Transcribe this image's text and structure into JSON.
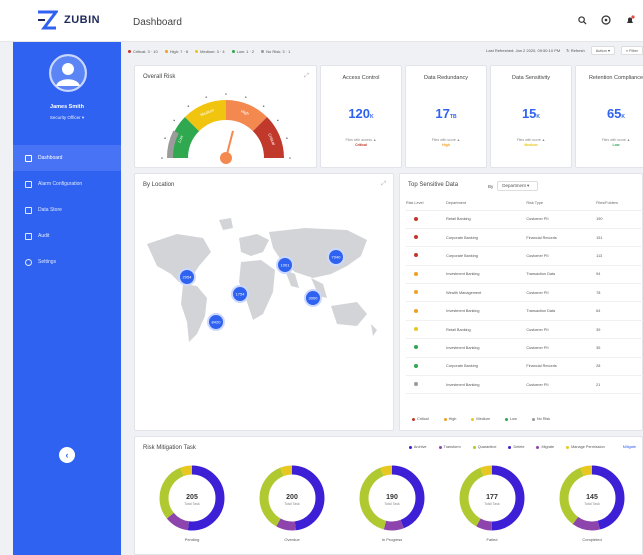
{
  "app": {
    "logo_text": "ZUBIN",
    "page_title": "Dashboard"
  },
  "user": {
    "name": "James Smith",
    "role": "Security Officer"
  },
  "nav": [
    {
      "label": "Dashboard",
      "active": true
    },
    {
      "label": "Alarm Configuration"
    },
    {
      "label": "Data Store"
    },
    {
      "label": "Audit"
    },
    {
      "label": "Settings"
    }
  ],
  "filters": {
    "risk_legend": [
      {
        "label": "Critical: 3 · 10",
        "color": "#c0392b"
      },
      {
        "label": "High: 7 · 8",
        "color": "#f0a020"
      },
      {
        "label": "Medium: 3 · 4",
        "color": "#e6c820"
      },
      {
        "label": "Low: 1 · 2",
        "color": "#2fa84f"
      },
      {
        "label": "No Risk: 3 · 1",
        "color": "#999999"
      }
    ],
    "last_refreshed": "Last Refreshed: Jan 2 2020, 09:50:10 PM",
    "refresh_label": "Refresh",
    "action_label": "Action",
    "filter_label": "Filter"
  },
  "gauge": {
    "title": "Overall Risk",
    "levels": [
      "Low",
      "Medium",
      "High",
      "Critical"
    ],
    "level_colors": [
      "#2fa84f",
      "#f1c40f",
      "#f3894f",
      "#c0392b"
    ],
    "needle_fraction": 0.58
  },
  "metrics": [
    {
      "title": "Access Control",
      "value": "120",
      "unit": "K",
      "note_prefix": "Files with access ▲",
      "note_level": "Critical",
      "note_color": "#c0392b"
    },
    {
      "title": "Data Redundancy",
      "value": "17",
      "unit": "TB",
      "note_prefix": "Files with score ▲",
      "note_level": "High",
      "note_color": "#f0a020"
    },
    {
      "title": "Data Sensitivity",
      "value": "15",
      "unit": "K",
      "note_prefix": "Files with score ▲",
      "note_level": "Medium",
      "note_color": "#e6c820"
    },
    {
      "title": "Retention Compliance",
      "value": "65",
      "unit": "K",
      "note_prefix": "Files with score ▲",
      "note_level": "Low",
      "note_color": "#2fa84f"
    }
  ],
  "location": {
    "title": "By Location",
    "bubbles": [
      "2054",
      "8420",
      "1001",
      "7040",
      "3000",
      "1754"
    ]
  },
  "sensitive": {
    "title": "Top Sensitive Data",
    "by_label": "By",
    "group_by": "Department",
    "columns": [
      "Risk Level",
      "Department",
      "Risk Type",
      "Files/Folders"
    ],
    "rows": [
      {
        "color": "#c0392b",
        "department": "Retail Banking",
        "risk_type": "Customer PII",
        "files": "190"
      },
      {
        "color": "#c0392b",
        "department": "Corporate Banking",
        "risk_type": "Financial Records",
        "files": "151"
      },
      {
        "color": "#c0392b",
        "department": "Corporate Banking",
        "risk_type": "Customer PII",
        "files": "113"
      },
      {
        "color": "#f0a020",
        "department": "Investment Banking",
        "risk_type": "Transaction Data",
        "files": "94"
      },
      {
        "color": "#f0a020",
        "department": "Wealth Management",
        "risk_type": "Customer PII",
        "files": "78"
      },
      {
        "color": "#f0a020",
        "department": "Investment Banking",
        "risk_type": "Transaction Data",
        "files": "64"
      },
      {
        "color": "#e6c820",
        "department": "Retail Banking",
        "risk_type": "Customer PII",
        "files": "39"
      },
      {
        "color": "#2fa84f",
        "department": "Investment Banking",
        "risk_type": "Customer PII",
        "files": "35"
      },
      {
        "color": "#2fa84f",
        "department": "Corporate Banking",
        "risk_type": "Financial Records",
        "files": "28"
      },
      {
        "color": "#999999",
        "department": "Investment Banking",
        "risk_type": "Customer PII",
        "files": "21"
      }
    ],
    "legend": [
      {
        "label": "Critical",
        "color": "#c0392b"
      },
      {
        "label": "High",
        "color": "#f0a020"
      },
      {
        "label": "Medium",
        "color": "#e6c820"
      },
      {
        "label": "Low",
        "color": "#2fa84f"
      },
      {
        "label": "No Risk",
        "color": "#999999"
      }
    ]
  },
  "mitigation": {
    "title": "Risk Mitigation Task",
    "legend": [
      {
        "label": "Archive",
        "color": "#3d1fd6"
      },
      {
        "label": "Transform",
        "color": "#8e44ad"
      },
      {
        "label": "Quarantine",
        "color": "#b0c930"
      },
      {
        "label": "Delete",
        "color": "#3d1fd6"
      },
      {
        "label": "Migrate",
        "color": "#8e44ad"
      },
      {
        "label": "Manage Permission",
        "color": "#e6c820"
      }
    ],
    "link_label": "Mitigate",
    "donut_sub": "Total Task",
    "donuts": [
      {
        "total": "205",
        "status": "Pending",
        "segments": [
          0.52,
          0.12,
          0.3,
          0.06
        ]
      },
      {
        "total": "200",
        "status": "Overdue",
        "segments": [
          0.48,
          0.1,
          0.36,
          0.06
        ]
      },
      {
        "total": "190",
        "status": "In Progress",
        "segments": [
          0.44,
          0.1,
          0.4,
          0.06
        ]
      },
      {
        "total": "177",
        "status": "Failed",
        "segments": [
          0.5,
          0.08,
          0.36,
          0.06
        ]
      },
      {
        "total": "145",
        "status": "Completed",
        "segments": [
          0.46,
          0.14,
          0.34,
          0.06
        ]
      }
    ],
    "donut_colors": [
      "#3d1fd6",
      "#8e44ad",
      "#b0c930",
      "#e6c820"
    ]
  }
}
